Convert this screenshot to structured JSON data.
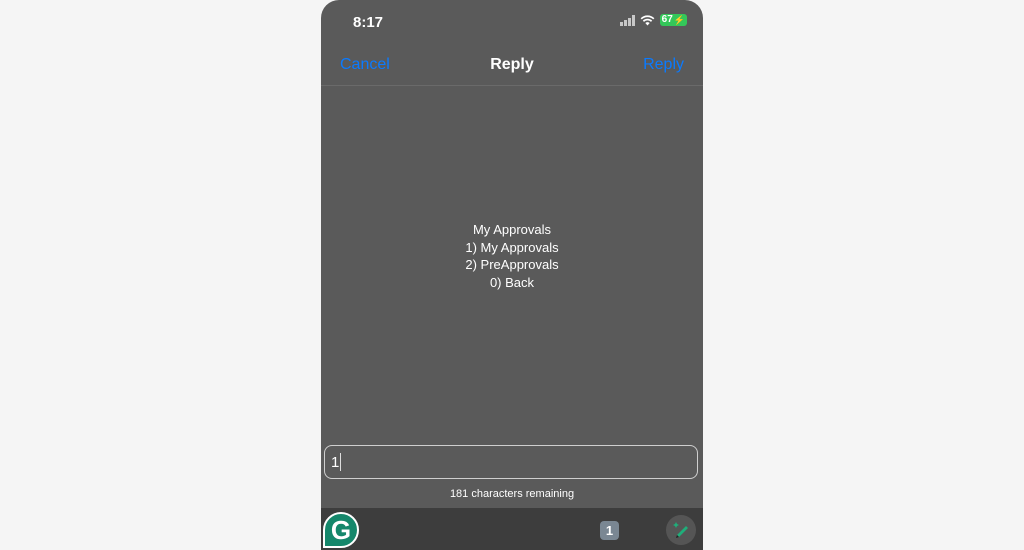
{
  "status_bar": {
    "time": "8:17",
    "battery_level": "67",
    "icons": [
      "signal-icon",
      "wifi-icon",
      "battery-charging-icon"
    ]
  },
  "nav": {
    "cancel_label": "Cancel",
    "title": "Reply",
    "reply_label": "Reply"
  },
  "message": {
    "lines": [
      "My Approvals",
      "1) My Approvals",
      "2) PreApprovals",
      "0) Back"
    ]
  },
  "input": {
    "value": "1"
  },
  "counter": {
    "text": "181 characters remaining"
  },
  "toolbar": {
    "grammarly_label": "G",
    "number_key_label": "1",
    "icons": [
      "grammarly-icon",
      "number-key-icon",
      "pencil-sparkle-icon"
    ]
  },
  "colors": {
    "accent": "#0a7aff",
    "background": "#5a5a5a",
    "toolbar": "#3d3d3d",
    "battery": "#34c759",
    "grammarly": "#15876b"
  }
}
